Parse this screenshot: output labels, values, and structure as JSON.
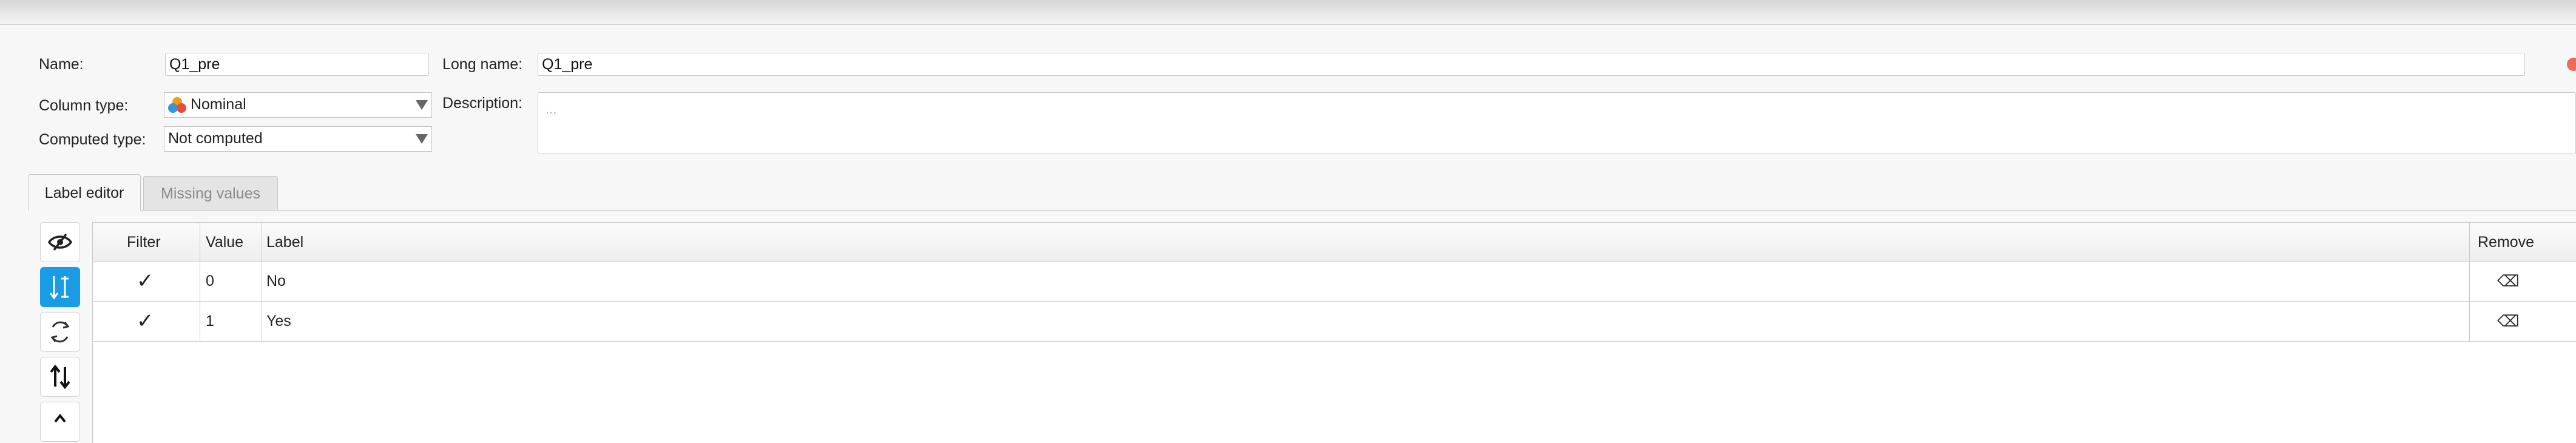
{
  "form": {
    "name_label": "Name:",
    "name_value": "Q1_pre",
    "long_name_label": "Long name:",
    "long_name_value": "Q1_pre",
    "column_type_label": "Column type:",
    "column_type_value": "Nominal",
    "computed_type_label": "Computed type:",
    "computed_type_value": "Not computed",
    "description_label": "Description:",
    "description_placeholder": "..."
  },
  "tabs": [
    {
      "label": "Label editor",
      "active": true
    },
    {
      "label": "Missing values",
      "active": false
    }
  ],
  "side_tools": [
    {
      "icon": "eye-slash-icon"
    },
    {
      "icon": "sort-ascending-icon",
      "active": true
    },
    {
      "icon": "reverse-icon"
    },
    {
      "icon": "swap-updown-icon"
    }
  ],
  "table": {
    "headers": {
      "filter": "Filter",
      "value": "Value",
      "label": "Label",
      "remove": "Remove"
    },
    "rows": [
      {
        "filter": "✓",
        "value": "0",
        "label": "No",
        "remove": "⌫"
      },
      {
        "filter": "✓",
        "value": "1",
        "label": "Yes",
        "remove": "⌫"
      }
    ]
  },
  "colors": {
    "accent": "#1a9be6"
  }
}
